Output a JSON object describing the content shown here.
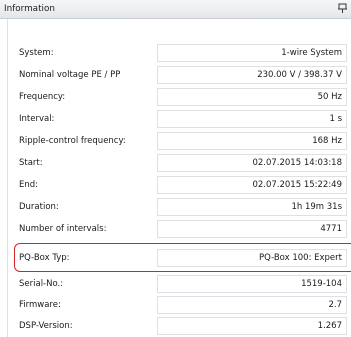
{
  "panel": {
    "title": "Information"
  },
  "rows": [
    {
      "label": "System:",
      "value": "1-wire System"
    },
    {
      "label": "Nominal voltage PE / PP",
      "value": "230.00 V / 398.37 V"
    },
    {
      "label": "Frequency:",
      "value": "50 Hz"
    },
    {
      "label": "Interval:",
      "value": "1 s"
    },
    {
      "label": "Ripple-control frequency:",
      "value": "168 Hz"
    },
    {
      "label": "Start:",
      "value": "02.07.2015 14:03:18"
    },
    {
      "label": "End:",
      "value": "02.07.2015 15:22:49"
    },
    {
      "label": "Duration:",
      "value": "1h 19m 31s"
    },
    {
      "label": "Number of intervals:",
      "value": "4771"
    },
    {
      "label": "PQ-Box Typ:",
      "value": "PQ-Box 100: Expert"
    },
    {
      "label": "Serial-No.:",
      "value": "1519-104"
    },
    {
      "label": "Firmware:",
      "value": "2.7"
    },
    {
      "label": "DSP-Version:",
      "value": "1.267"
    }
  ],
  "highlight": {
    "color": "#d42424"
  }
}
